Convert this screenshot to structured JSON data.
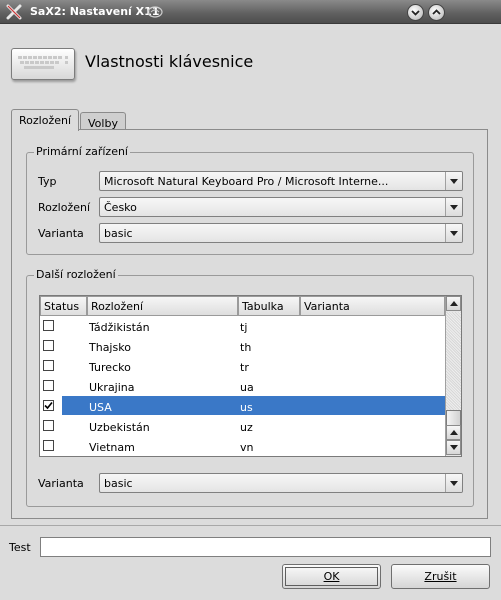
{
  "window": {
    "title": "SaX2: Nastavení X11",
    "icons": [
      "sax-x-icon",
      "hint-icon",
      "minimize-icon",
      "maximize-icon"
    ]
  },
  "header": {
    "icon": "keyboard-icon",
    "title": "Vlastnosti klávesnice"
  },
  "tabs": [
    {
      "label": "Rozložení",
      "active": true
    },
    {
      "label": "Volby",
      "active": false
    }
  ],
  "primary": {
    "legend": "Primární zařízení",
    "type_label": "Typ",
    "type_value": "Microsoft Natural Keyboard Pro / Microsoft Interne...",
    "layout_label": "Rozložení",
    "layout_value": "Česko",
    "variant_label": "Varianta",
    "variant_value": "basic"
  },
  "additional": {
    "legend": "Další rozložení",
    "columns": [
      "Status",
      "Rozložení",
      "Tabulka",
      "Varianta"
    ],
    "rows": [
      {
        "checked": false,
        "layout": "Tádžikistán",
        "table": "tj",
        "variant": "",
        "selected": false
      },
      {
        "checked": false,
        "layout": "Thajsko",
        "table": "th",
        "variant": "",
        "selected": false
      },
      {
        "checked": false,
        "layout": "Turecko",
        "table": "tr",
        "variant": "",
        "selected": false
      },
      {
        "checked": false,
        "layout": "Ukrajina",
        "table": "ua",
        "variant": "",
        "selected": false
      },
      {
        "checked": true,
        "layout": "USA",
        "table": "us",
        "variant": "",
        "selected": true
      },
      {
        "checked": false,
        "layout": "Uzbekistán",
        "table": "uz",
        "variant": "",
        "selected": false
      },
      {
        "checked": false,
        "layout": "Vietnam",
        "table": "vn",
        "variant": "",
        "selected": false
      }
    ],
    "variant_label": "Varianta",
    "variant_value": "basic"
  },
  "test": {
    "label": "Test",
    "value": ""
  },
  "buttons": {
    "ok": "OK",
    "cancel": "Zrušit"
  },
  "colors": {
    "selection": "#3a78c7",
    "window_bg": "#dcdcdc",
    "titlebar": "#5f5f5f"
  }
}
